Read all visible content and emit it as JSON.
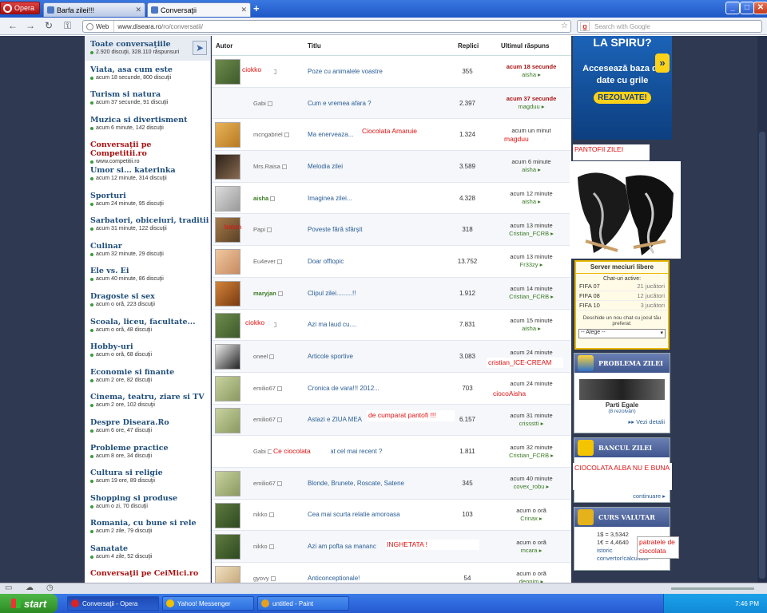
{
  "browser": {
    "menu_label": "Opera",
    "tabs": [
      {
        "label": "Barfa zilei!!!"
      },
      {
        "label": "Conversaţii"
      }
    ],
    "new_tab": "+",
    "address": {
      "mode": "Web",
      "url_host": "www.diseara.ro",
      "url_path": "/ro/conversatii/"
    },
    "search_placeholder": "Search with Google",
    "window_buttons": {
      "min": "_",
      "max": "□",
      "close": "✕"
    }
  },
  "sidebar": {
    "categories": [
      {
        "title": "Toate conversaţiile",
        "sub": "2.920 discuţii, 328.110 răspunsuri",
        "selected": true
      },
      {
        "title": "Viata, asa cum este",
        "sub": "acum 18 secunde, 800 discuţii"
      },
      {
        "title": "Turism si natura",
        "sub": "acum 37 secunde, 91 discuţii"
      },
      {
        "title": "Muzica si divertisment",
        "sub": "acum 6 minute, 142 discuţii"
      },
      {
        "title": "Conversaţii pe Competitii.ro",
        "sub": "www.competitii.ro",
        "highlight": true
      },
      {
        "title": "Umor si... katerinka",
        "sub": "acum 12 minute, 314 discuţii"
      },
      {
        "title": "Sporturi",
        "sub": "acum 24 minute, 95 discuţii"
      },
      {
        "title": "Sarbatori, obiceiuri, traditii",
        "sub": "acum 31 minute, 122 discuţii"
      },
      {
        "title": "Culinar",
        "sub": "acum 32 minute, 29 discuţii"
      },
      {
        "title": "Ele vs. Ei",
        "sub": "acum 40 minute, 86 discuţii"
      },
      {
        "title": "Dragoste si sex",
        "sub": "acum o oră, 223 discuţii"
      },
      {
        "title": "Scoala, liceu, facultate...",
        "sub": "acum o oră, 48 discuţii"
      },
      {
        "title": "Hobby-uri",
        "sub": "acum o oră, 68 discuţii"
      },
      {
        "title": "Economie si finante",
        "sub": "acum 2 ore, 82 discuţii"
      },
      {
        "title": "Cinema, teatru, ziare si TV",
        "sub": "acum 2 ore, 102 discuţii"
      },
      {
        "title": "Despre Diseara.Ro",
        "sub": "acum 6 ore, 47 discuţii"
      },
      {
        "title": "Probleme practice",
        "sub": "acum 8 ore, 34 discuţii"
      },
      {
        "title": "Cultura si religie",
        "sub": "acum 19 ore, 89 discuţii"
      },
      {
        "title": "Shopping si produse",
        "sub": "acum o zi, 70 discuţii"
      },
      {
        "title": "Romania, cu bune si rele",
        "sub": "acum 2 zile, 79 discuţii"
      },
      {
        "title": "Sanatate",
        "sub": "acum 4 zile, 52 discuţii"
      },
      {
        "title": "Conversaţii pe CeiMici.ro",
        "sub": "",
        "highlight": true
      }
    ]
  },
  "table": {
    "headers": {
      "author": "Autor",
      "title": "Titlu",
      "replies": "Replici",
      "last": "Ultimul răspuns"
    },
    "rows": [
      {
        "author": "ciokko",
        "avatar": true,
        "title": "Poze cu animalele voastre",
        "replies": "355",
        "time": "acum 18 secunde",
        "user": "aisha",
        "red": true
      },
      {
        "author": "Gabi",
        "avatar": false,
        "title": "Cum e vremea afara ?",
        "replies": "2.397",
        "time": "acum 37 secunde",
        "user": "magduu",
        "red": true
      },
      {
        "author": "mcngabriel",
        "avatar": true,
        "title": "Ma enerveaza...",
        "replies": "1.324",
        "time": "acum un minut",
        "user": "magduu"
      },
      {
        "author": "Mrs.Raisa",
        "avatar": true,
        "title": "Melodia zilei",
        "replies": "3.589",
        "time": "acum 6 minute",
        "user": "aisha"
      },
      {
        "author": "aisha",
        "avatar": true,
        "online": true,
        "title": "Imaginea zilei...",
        "replies": "4.328",
        "time": "acum 12 minute",
        "user": "aisha"
      },
      {
        "author": "Papi",
        "avatar": true,
        "title": "Poveste fără sfârşit",
        "replies": "318",
        "time": "acum 13 minute",
        "user": "Cristian_FCRB"
      },
      {
        "author": "Eu4ever",
        "avatar": true,
        "title": "Doar offtopic",
        "replies": "13.752",
        "time": "acum 13 minute",
        "user": "Fr33zy"
      },
      {
        "author": "maryjan",
        "avatar": true,
        "online": true,
        "title": "Clipul zilei.........!!",
        "replies": "1.912",
        "time": "acum 14 minute",
        "user": "Cristian_FCRB"
      },
      {
        "author": "ciokko",
        "avatar": true,
        "title": "Azi ma laud cu....",
        "replies": "7.831",
        "time": "acum 15 minute",
        "user": "aisha"
      },
      {
        "author": "oneel",
        "avatar": true,
        "title": "Articole sportive",
        "replies": "3.083",
        "time": "acum 24 minute",
        "user": ""
      },
      {
        "author": "emilio67",
        "avatar": true,
        "title": "Cronica de vara!!! 2012...",
        "replies": "703",
        "time": "acum 24 minute",
        "user": ""
      },
      {
        "author": "emilio67",
        "avatar": true,
        "title": "Astazi e ZIUA MEA",
        "replies": "6.157",
        "time": "acum 31 minute",
        "user": "crissstti"
      },
      {
        "author": "Gabi",
        "avatar": false,
        "title": "ai mancat cel mai recent ?",
        "replies": "1.811",
        "time": "acum 32 minute",
        "user": "Cristian_FCRB"
      },
      {
        "author": "emilio67",
        "avatar": true,
        "title": "Blonde, Brunete, Roscate, Satene",
        "replies": "345",
        "time": "acum 40 minute",
        "user": "covex_robu"
      },
      {
        "author": "nikko",
        "avatar": true,
        "title": "Cea mai scurta relatie amoroasa",
        "replies": "103",
        "time": "acum o oră",
        "user": "Crinax"
      },
      {
        "author": "nikko",
        "avatar": true,
        "title": "Azi am pofta sa mananc",
        "replies": "1.806",
        "time": "acum o oră",
        "user": "mcara"
      },
      {
        "author": "gyovy",
        "avatar": true,
        "title": "Anticonceptionale!",
        "replies": "54",
        "time": "acum o oră",
        "user": "deonim"
      }
    ]
  },
  "paint_labels": {
    "ciokko1": "ciokko",
    "ciocolata": "Ciocolata Amaruie",
    "magduu": "magduu",
    "baton": "baton",
    "ciokko2": "ciokko",
    "cristian": "cristian_ICE-CREAM",
    "cioco": "ciocoAisha",
    "pantofi": "de cumparat pantofi !!!",
    "ceciocolata": "Ce ciocolata",
    "inghetata": "INGHETATA !",
    "pantofii_zilei": "PANTOFII ZILEI",
    "alba": "CIOCOLATA ALBA NU E BUNA",
    "patratele": "patratele de ciocolata"
  },
  "ads": {
    "spiru": {
      "top": "LA SPIRU?",
      "text": "Accesează baza de date cu grile",
      "button": "REZOLVATE!",
      "arrow": "»"
    },
    "server": {
      "title": "Server meciuri libere",
      "chats": "Chat-uri active:",
      "games": [
        {
          "name": "FIFA 07",
          "count": "21 jucători"
        },
        {
          "name": "FIFA 08",
          "count": "12 jucători"
        },
        {
          "name": "FIFA 10",
          "count": "3 jucători"
        }
      ],
      "desc": "Deschide un nou chat cu jocul tău preferat:",
      "select": "-- Alege --"
    },
    "problema": {
      "title": "PROBLEMA ZILEI",
      "name": "Parti Egale",
      "sub": "(8 rezolvări)",
      "link": "Vezi detalii"
    },
    "bancul": {
      "title": "BANCUL ZILEI",
      "link": "continuare"
    },
    "curs": {
      "title": "CURS VALUTAR",
      "usd": "1$ = 3,5342",
      "eur": "1€ = 4,4640",
      "istoric": "istoric",
      "conv": "convertor/calculator"
    }
  },
  "taskbar": {
    "start": "start",
    "tasks": [
      {
        "label": "Conversaţii - Opera"
      },
      {
        "label": "Yahoo! Messenger"
      },
      {
        "label": "untitled - Paint"
      }
    ],
    "clock": "7:46 PM"
  },
  "colors": {
    "accent": "#1f4e7a",
    "paint_red": "#e01010",
    "taskbar": "#2559d1"
  }
}
